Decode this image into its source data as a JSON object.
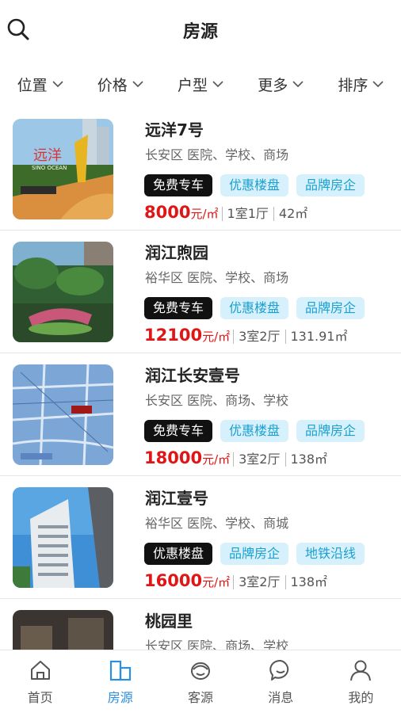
{
  "header": {
    "title": "房源"
  },
  "filters": [
    {
      "label": "位置"
    },
    {
      "label": "价格"
    },
    {
      "label": "户型"
    },
    {
      "label": "更多"
    },
    {
      "label": "排序"
    }
  ],
  "listings": [
    {
      "name": "远洋7号",
      "address": "长安区 医院、学校、商场",
      "tags": [
        "免费专车",
        "优惠楼盘",
        "品牌房企"
      ],
      "price": "8000",
      "unit": "元/㎡",
      "layout": "1室1厅",
      "area": "42㎡",
      "image_sign": "远洋",
      "image_sign_en": "SINO OCEAN"
    },
    {
      "name": "润江煦园",
      "address": "裕华区 医院、学校、商场",
      "tags": [
        "免费专车",
        "优惠楼盘",
        "品牌房企"
      ],
      "price": "12100",
      "unit": "元/㎡",
      "layout": "3室2厅",
      "area": "131.91㎡"
    },
    {
      "name": "润江长安壹号",
      "address": "长安区 医院、商场、学校",
      "tags": [
        "免费专车",
        "优惠楼盘",
        "品牌房企"
      ],
      "price": "18000",
      "unit": "元/㎡",
      "layout": "3室2厅",
      "area": "138㎡"
    },
    {
      "name": "润江壹号",
      "address": "裕华区 医院、学校、商城",
      "tags": [
        "优惠楼盘",
        "品牌房企",
        "地铁沿线"
      ],
      "price": "16000",
      "unit": "元/㎡",
      "layout": "3室2厅",
      "area": "138㎡"
    },
    {
      "name": "桃园里",
      "address": "长安区 医院、商场、学校"
    }
  ],
  "tabbar": [
    {
      "label": "首页",
      "icon": "home-icon"
    },
    {
      "label": "房源",
      "icon": "building-icon",
      "active": true
    },
    {
      "label": "客源",
      "icon": "client-icon"
    },
    {
      "label": "消息",
      "icon": "message-icon"
    },
    {
      "label": "我的",
      "icon": "profile-icon"
    }
  ],
  "colors": {
    "accent": "#2a8fe0",
    "price": "#e01515",
    "tag_dark_bg": "#111111",
    "tag_light_bg": "#d6f1fb",
    "tag_light_text": "#1a9fd0"
  }
}
